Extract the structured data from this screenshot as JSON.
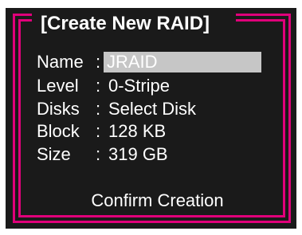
{
  "dialog": {
    "title": "[Create New RAID]",
    "fields": [
      {
        "label": "Name",
        "sep": ":",
        "value": "JRAID"
      },
      {
        "label": "Level",
        "sep": ":",
        "value": "0-Stripe"
      },
      {
        "label": "Disks",
        "sep": ":",
        "value": "Select Disk"
      },
      {
        "label": "Block",
        "sep": ":",
        "value": "128 KB"
      },
      {
        "label": "Size",
        "sep": ":",
        "value": "319 GB"
      }
    ],
    "confirm_label": "Confirm Creation"
  },
  "colors": {
    "background": "#1a1a1a",
    "frame": "#e0007a",
    "text": "#ffffff",
    "highlight": "#c6c6c6"
  }
}
